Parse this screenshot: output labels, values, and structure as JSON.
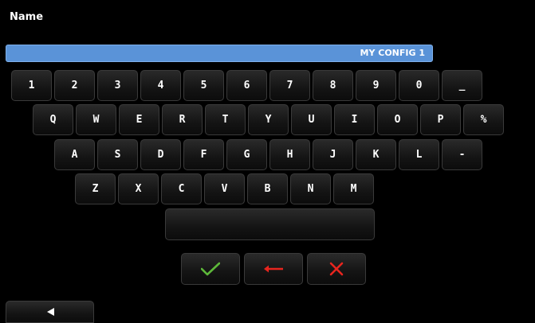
{
  "header": {
    "title": "Name"
  },
  "name_field": {
    "value": "MY CONFIG 1"
  },
  "keyboard": {
    "row1": [
      "1",
      "2",
      "3",
      "4",
      "5",
      "6",
      "7",
      "8",
      "9",
      "0",
      "_"
    ],
    "row2": [
      "Q",
      "W",
      "E",
      "R",
      "T",
      "Y",
      "U",
      "I",
      "O",
      "P",
      "%"
    ],
    "row3": [
      "A",
      "S",
      "D",
      "F",
      "G",
      "H",
      "J",
      "K",
      "L",
      "-"
    ],
    "row4": [
      "Z",
      "X",
      "C",
      "V",
      "B",
      "N",
      "M"
    ]
  },
  "actions": {
    "accept": {
      "icon": "checkmark-icon",
      "color": "#5db83a"
    },
    "backspace": {
      "icon": "left-arrow-icon",
      "color": "#e8251e"
    },
    "cancel": {
      "icon": "x-icon",
      "color": "#e8251e"
    }
  },
  "nav": {
    "back": {
      "icon": "back-triangle-icon",
      "color": "#ffffff"
    }
  }
}
